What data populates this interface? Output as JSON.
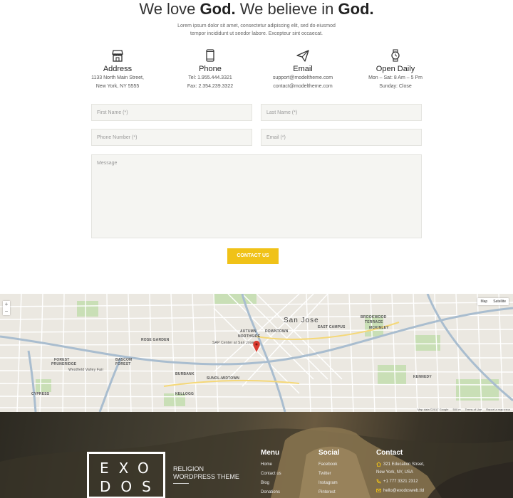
{
  "hero": {
    "title_pre": "We love ",
    "title_b1": "God.",
    "title_mid": " We believe in ",
    "title_b2": "God.",
    "desc_line1": "Lorem ipsum dolor sit amet, consectetur adipiscing elit, sed do eiusmod",
    "desc_line2": "tempor incididunt ut seedor labore. Excepteur sint occaecat."
  },
  "info": [
    {
      "icon": "shop-icon",
      "title": "Address",
      "line1": "1133 North Main Street,",
      "line2": "New York, NY 5555"
    },
    {
      "icon": "phone-icon",
      "title": "Phone",
      "line1": "Tel: 1.955.444.3321",
      "line2": "Fax: 2.354.239.3322"
    },
    {
      "icon": "paper-plane-icon",
      "title": "Email",
      "line1": "support@modeltheme.com",
      "line2": "contact@modeltheme.com"
    },
    {
      "icon": "watch-icon",
      "title": "Open Daily",
      "line1": "Mon – Sat: 8 Am – 5 Pm",
      "line2": "Sunday: Close"
    }
  ],
  "form": {
    "first_name": "First Name (*)",
    "last_name": "Last Name (*)",
    "phone": "Phone Number (*)",
    "email": "Email (*)",
    "message": "Message",
    "submit": "CONTACT US"
  },
  "map": {
    "city": "San Jose",
    "type_map": "Map",
    "type_satellite": "Satellite",
    "zoom_in": "+",
    "zoom_out": "−",
    "footer_data": "Map data ©2017 Google",
    "footer_scale": "500 m",
    "footer_terms": "Terms of Use",
    "footer_report": "Report a map error",
    "labels": {
      "rose_garden": "ROSE GARDEN",
      "autumn": "AUTUMN",
      "northside": "NORTHSIDE",
      "downtown": "DOWNTOWN",
      "east_campus": "EAST CAMPUS",
      "brookwood": "BROOKWOOD",
      "terrace": "TERRACE",
      "mckinley": "MCKINLEY",
      "forest": "FOREST",
      "pruneridge": "PRUNERIDGE",
      "bascom": "BASCOM",
      "forest2": "FOREST",
      "kennedy": "KENNEDY",
      "cypress": "CYPRESS",
      "burbank": "BURBANK",
      "sunol": "SUNOL-MIDTOWN",
      "kellogg": "KELLOGG",
      "westfield": "Westfield Valley Fair",
      "sap_center": "SAP Center at San Jose"
    }
  },
  "footer": {
    "logo_line1": "EXO",
    "logo_line2": "DOS",
    "tagline1": "RELIGION",
    "tagline2": "WORDPRESS THEME",
    "menu_title": "Menu",
    "menu_items": [
      "Home",
      "Contact us",
      "Blog",
      "Donations"
    ],
    "social_title": "Social",
    "social_items": [
      "Facebook",
      "Twitter",
      "Instagram",
      "Pinterest"
    ],
    "contact_title": "Contact",
    "contact_address1": "321 Education Street,",
    "contact_address2": "New York, NY, USA",
    "contact_phone": "+1 777 3321 2312",
    "contact_email": "hello@exodosweb.tld"
  },
  "colors": {
    "accent": "#f0c218",
    "field_bg": "#f5f5f2",
    "map_pin": "#d93a2f"
  }
}
